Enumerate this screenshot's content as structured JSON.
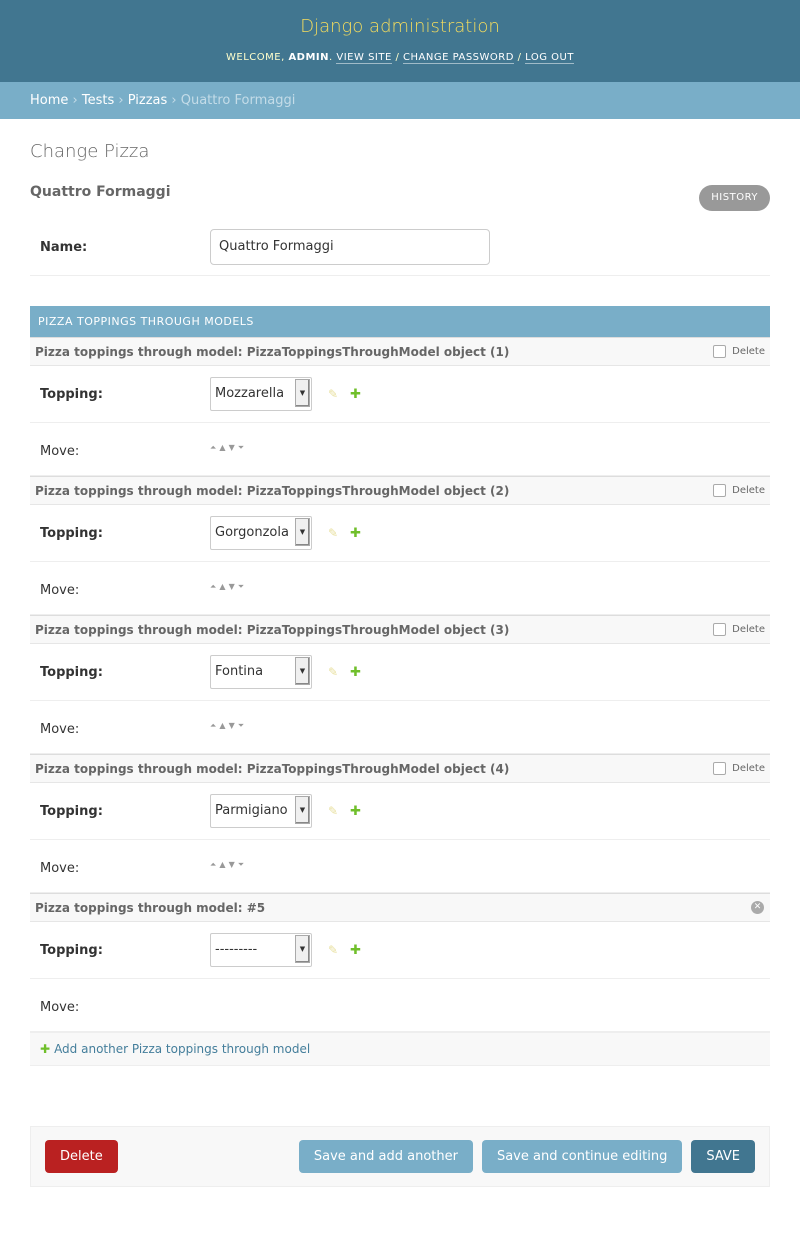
{
  "header": {
    "site_name": "Django administration",
    "welcome": "WELCOME, ",
    "username": "ADMIN",
    "period": ". ",
    "view_site": "VIEW SITE",
    "sep": " / ",
    "change_password": "CHANGE PASSWORD",
    "log_out": "LOG OUT"
  },
  "breadcrumbs": {
    "home": "Home",
    "tests": "Tests",
    "pizzas": "Pizzas",
    "current": "Quattro Formaggi",
    "separator": " › "
  },
  "page": {
    "title": "Change Pizza",
    "object_title": "Quattro Formaggi",
    "history": "HISTORY"
  },
  "name_field": {
    "label": "Name:",
    "value": "Quattro Formaggi"
  },
  "inline": {
    "heading": "PIZZA TOPPINGS THROUGH MODELS",
    "delete_label": "Delete",
    "topping_label": "Topping:",
    "move_label": "Move:",
    "rows": [
      {
        "title": "Pizza toppings through model: PizzaToppingsThroughModel object (1)",
        "topping": "Mozzarella"
      },
      {
        "title": "Pizza toppings through model: PizzaToppingsThroughModel object (2)",
        "topping": "Gorgonzola"
      },
      {
        "title": "Pizza toppings through model: PizzaToppingsThroughModel object (3)",
        "topping": "Fontina"
      },
      {
        "title": "Pizza toppings through model: PizzaToppingsThroughModel object (4)",
        "topping": "Parmigiano"
      }
    ],
    "new_row": {
      "title": "Pizza toppings through model: #5",
      "topping": "---------"
    },
    "add_another": "Add another Pizza toppings through model"
  },
  "submit": {
    "delete": "Delete",
    "save_add_another": "Save and add another",
    "save_continue": "Save and continue editing",
    "save": "SAVE"
  },
  "icons": {
    "pencil": "pencil-icon",
    "plus": "plus-icon",
    "move": [
      "move-top-icon",
      "move-up-icon",
      "move-down-icon",
      "move-bottom-icon"
    ],
    "remove": "remove-icon"
  },
  "colors": {
    "header_bg": "#417690",
    "site_name": "#f5dd5d",
    "breadcrumbs_bg": "#79aec8",
    "delete_red": "#ba2121",
    "add_green": "#70bf2b"
  }
}
